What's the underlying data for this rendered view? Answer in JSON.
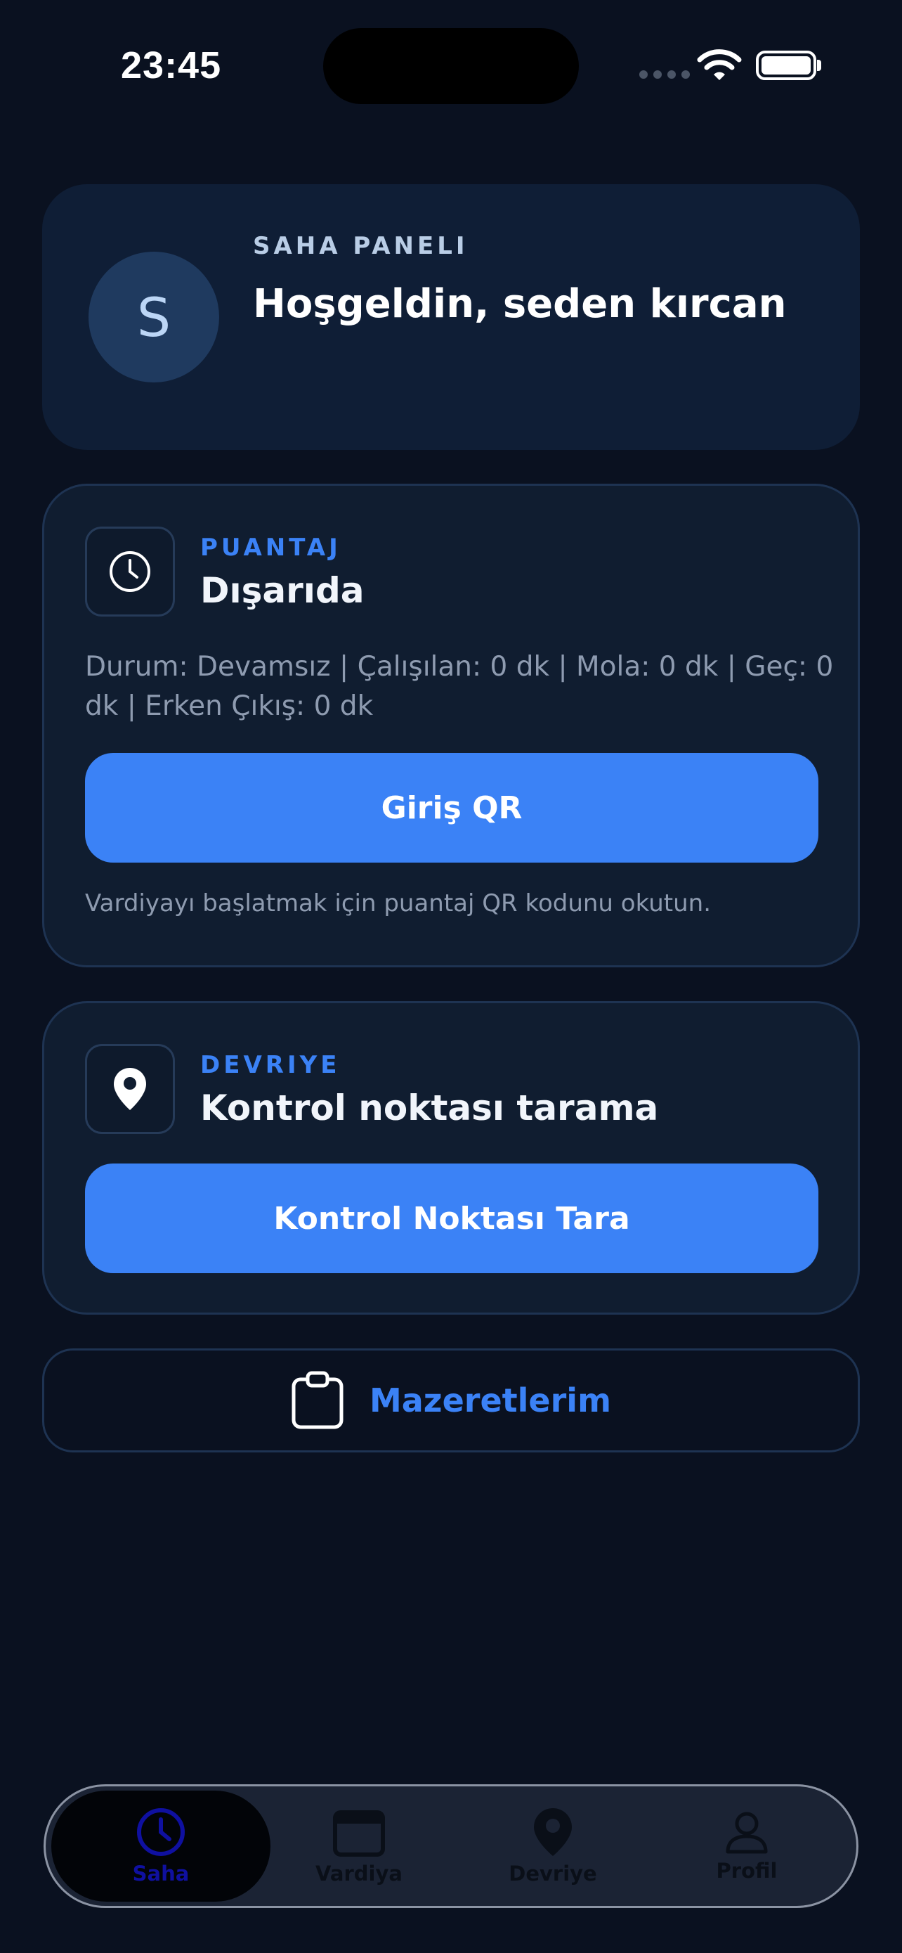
{
  "status_bar": {
    "time": "23:45"
  },
  "welcome": {
    "avatar_initial": "S",
    "eyebrow": "SAHA PANELI",
    "title": "Hoşgeldin, seden kırcan"
  },
  "attendance": {
    "icon": "clock-icon",
    "eyebrow": "PUANTAJ",
    "title": "Dışarıda",
    "status_line": "Durum: Devamsız | Çalışılan: 0 dk | Mola: 0 dk | Geç: 0 dk | Erken Çıkış: 0 dk",
    "button_label": "Giriş QR",
    "hint": "Vardiyayı başlatmak için puantaj QR kodunu okutun."
  },
  "patrol": {
    "icon": "location-pin-icon",
    "eyebrow": "DEVRIYE",
    "title": "Kontrol noktası tarama",
    "button_label": "Kontrol Noktası Tara"
  },
  "excuses": {
    "icon": "clipboard-icon",
    "label": "Mazeretlerim"
  },
  "tab_bar": {
    "active": "Saha",
    "tabs": [
      {
        "label": "Saha",
        "icon": "clock-icon"
      },
      {
        "label": "Vardiya",
        "icon": "calendar-icon"
      },
      {
        "label": "Devriye",
        "icon": "location-pin-icon"
      },
      {
        "label": "Profil",
        "icon": "person-icon"
      }
    ]
  },
  "colors": {
    "background": "#0a1120",
    "card": "#101d30",
    "accent": "#3b82f6",
    "active_tab_text": "#0f10a0"
  }
}
